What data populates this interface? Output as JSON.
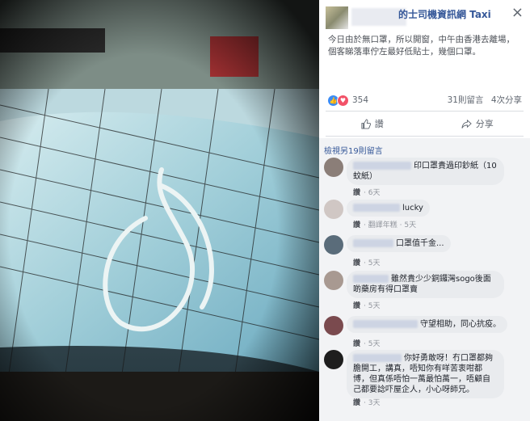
{
  "post": {
    "page_name": "的士司機資訊網 Taxi",
    "text": "今日由於無口罩，所以開窗，中午由香港去離場，個客睇落車佇左最好低貼士，幾個口罩。",
    "reaction_count": "354",
    "comments_count": "31則留言",
    "shares_count": "4次分享",
    "like_label": "讚",
    "share_label": "分享",
    "view_more": "檢視另19則留言",
    "close": "×"
  },
  "comments": [
    {
      "text": "印口罩貴過印鈔紙（10蚊紙）",
      "like": "讚",
      "time": "6天",
      "translate": ""
    },
    {
      "text": "lucky",
      "like": "讚",
      "time": "5天",
      "translate": "翻譯年糕"
    },
    {
      "text": "口罩值千金...",
      "like": "讚",
      "time": "5天",
      "translate": ""
    },
    {
      "text": "雖然貴少少銅鑼灣sogo後面啲藥房有得口罩賣",
      "like": "讚",
      "time": "5天",
      "translate": ""
    },
    {
      "text": "守望相助，同心抗疫。",
      "like": "讚",
      "time": "5天",
      "translate": ""
    },
    {
      "text": "你好勇敢呀！冇口罩都夠膽開工，講真，唔知你有咩苦衷咁都博，但真係唔怕一萬最怕萬一，唔顧自己都要諗吓屋企人，小心呀師兄。",
      "like": "讚",
      "time": "3天",
      "translate": ""
    }
  ]
}
